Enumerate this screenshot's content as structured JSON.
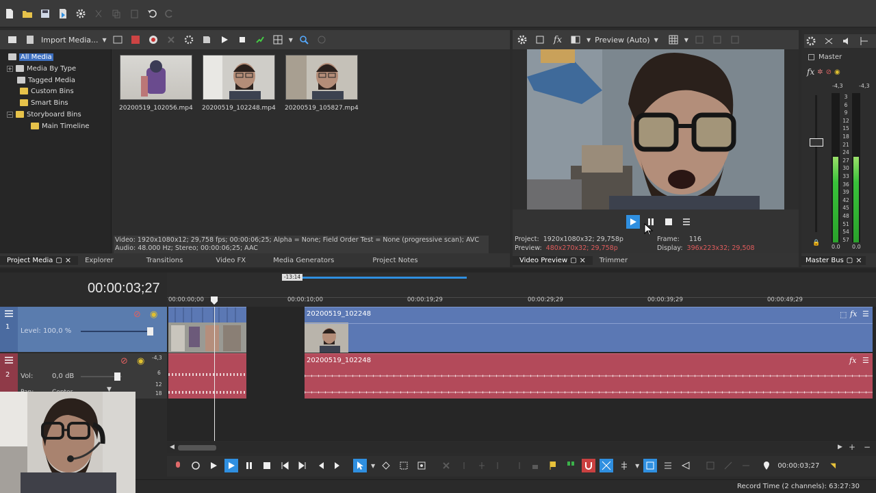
{
  "media": {
    "import_label": "Import Media...",
    "tree": [
      {
        "label": "All Media",
        "expander": "",
        "folder": false
      },
      {
        "label": "Media By Type",
        "expander": "+",
        "folder": false
      },
      {
        "label": "Tagged Media",
        "expander": "",
        "folder": false
      },
      {
        "label": "Custom Bins",
        "expander": "",
        "folder": true
      },
      {
        "label": "Smart Bins",
        "expander": "",
        "folder": true
      },
      {
        "label": "Storyboard Bins",
        "expander": "−",
        "folder": true
      },
      {
        "label": "Main Timeline",
        "expander": "",
        "folder": true
      }
    ],
    "items": [
      {
        "name": "20200519_102056.mp4"
      },
      {
        "name": "20200519_102248.mp4"
      },
      {
        "name": "20200519_105827.mp4"
      }
    ],
    "info_video": "Video: 1920x1080x12; 29,758 fps; 00:00:06;25; Alpha = None; Field Order Test = None (progressive scan); AVC",
    "info_audio": "Audio: 48.000 Hz; Stereo; 00:00:06;25; AAC",
    "tabs": [
      "Project Media",
      "Explorer",
      "Transitions",
      "Video FX",
      "Media Generators",
      "Project Notes"
    ]
  },
  "preview": {
    "mode": "Preview (Auto)",
    "project_label": "Project:",
    "project_value": "1920x1080x32; 29,758p",
    "preview_label": "Preview:",
    "preview_value": "480x270x32; 29,758p",
    "frame_label": "Frame:",
    "frame_value": "116",
    "display_label": "Display:",
    "display_value": "396x223x32; 29,508",
    "tabs": [
      "Video Preview",
      "Trimmer"
    ]
  },
  "master": {
    "title": "Master",
    "peak_left": "-4,3",
    "peak_right": "-4,3",
    "scale": [
      "3",
      "6",
      "9",
      "12",
      "15",
      "18",
      "21",
      "24",
      "27",
      "30",
      "33",
      "36",
      "39",
      "42",
      "45",
      "48",
      "51",
      "54",
      "57"
    ],
    "level_left": "0.0",
    "level_right": "0.0",
    "tab": "Master Bus"
  },
  "timeline": {
    "timecode": "00:00:03;27",
    "loop_marker": "-13:14",
    "ruler_labels": [
      "00:00:00;00",
      "00:00:10;00",
      "00:00:19;29",
      "00:00:29;29",
      "00:00:39;29",
      "00:00:49;29"
    ],
    "video_track": {
      "num": "1",
      "level": "Level: 100,0 %"
    },
    "audio_track": {
      "num": "2",
      "vol_label": "Vol:",
      "vol_value": "0,0 dB",
      "pan_label": "Pan:",
      "pan_value": "Center",
      "peak": "-4,3",
      "db_marks": [
        "6",
        "12",
        "18"
      ]
    },
    "clip_name_video": "20200519_102248",
    "clip_name_audio": "20200519_102248",
    "transport_time": "00:00:03;27"
  },
  "status": {
    "record_time": "Record Time (2 channels): 63:27:30"
  },
  "colors": {
    "video_track": "#5b78b4",
    "audio_track": "#b34a5a",
    "accent": "#2f8fe0",
    "meter": "#39c23a"
  }
}
